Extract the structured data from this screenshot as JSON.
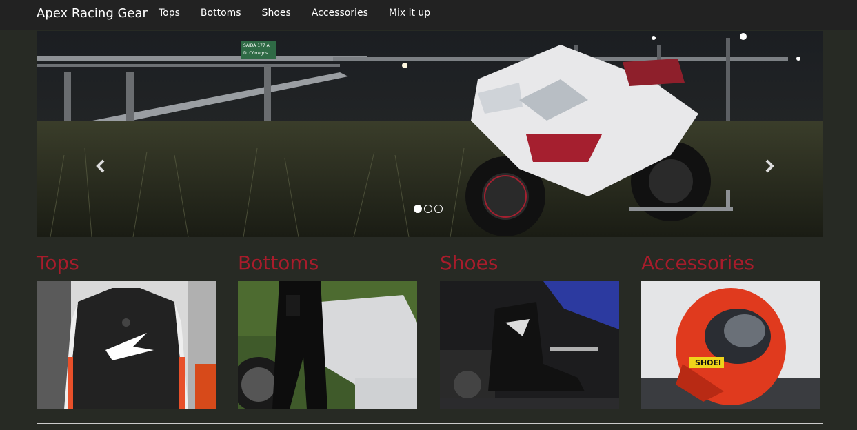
{
  "navbar": {
    "brand": "Apex Racing Gear",
    "links": [
      "Tops",
      "Bottoms",
      "Shoes",
      "Accessories",
      "Mix it up"
    ]
  },
  "carousel": {
    "slides": 3,
    "active_index": 0,
    "sign_text": [
      "SAÍDA 177 A",
      "D. Córregos"
    ],
    "prev_icon": "chevron-left-icon",
    "next_icon": "chevron-right-icon"
  },
  "categories": [
    {
      "title": "Tops",
      "image": "leather-racing-jacket"
    },
    {
      "title": "Bottoms",
      "image": "racing-pants-on-bike"
    },
    {
      "title": "Shoes",
      "image": "racing-boot-on-peg"
    },
    {
      "title": "Accessories",
      "image": "red-racing-helmet"
    }
  ],
  "colors": {
    "background": "#272a24",
    "navbar": "#222222",
    "heading": "#a81c2b"
  }
}
